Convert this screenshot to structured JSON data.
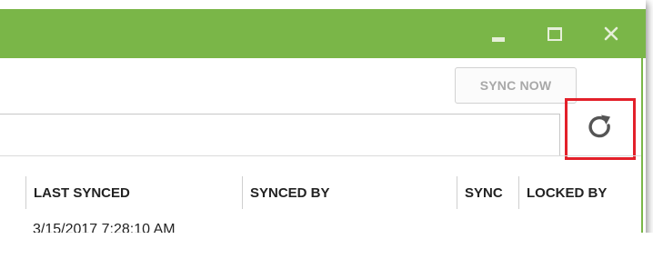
{
  "window": {
    "accent_color": "#7ab648",
    "controls": {
      "minimize_icon": "minimize-icon",
      "maximize_icon": "maximize-icon",
      "close_icon": "close-icon"
    }
  },
  "toolbar": {
    "sync_now_label": "SYNC NOW",
    "refresh_icon": "refresh-icon",
    "highlight_color": "#e3202a"
  },
  "search": {
    "value": ""
  },
  "table": {
    "columns": [
      "LAST SYNCED",
      "SYNCED BY",
      "SYNC",
      "LOCKED BY"
    ],
    "rows": [
      {
        "last_synced": "3/15/2017 7:28:10 AM"
      }
    ]
  }
}
